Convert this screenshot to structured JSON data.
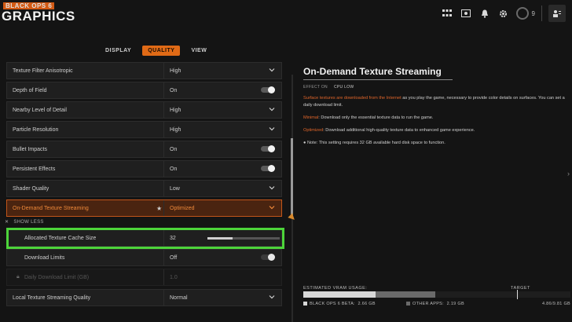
{
  "header": {
    "game_title": "BLACK OPS 6",
    "page_title": "GRAPHICS",
    "notification_count": "9"
  },
  "tabs": [
    {
      "label": "DISPLAY",
      "active": false
    },
    {
      "label": "QUALITY",
      "active": true
    },
    {
      "label": "VIEW",
      "active": false
    }
  ],
  "settings": [
    {
      "label": "Texture Filter Anisotropic",
      "value": "High",
      "control": "dropdown"
    },
    {
      "label": "Depth of Field",
      "value": "On",
      "control": "toggle"
    },
    {
      "label": "Nearby Level of Detail",
      "value": "High",
      "control": "dropdown"
    },
    {
      "label": "Particle Resolution",
      "value": "High",
      "control": "dropdown"
    },
    {
      "label": "Bullet Impacts",
      "value": "On",
      "control": "toggle"
    },
    {
      "label": "Persistent Effects",
      "value": "On",
      "control": "toggle"
    },
    {
      "label": "Shader Quality",
      "value": "Low",
      "control": "dropdown"
    },
    {
      "label": "On-Demand Texture Streaming",
      "value": "Optimized",
      "control": "dropdown"
    }
  ],
  "show_less": "SHOW LESS",
  "sub_settings": {
    "cache_label": "Allocated Texture Cache Size",
    "cache_value": "32",
    "cache_fraction": 0.35,
    "download_limits_label": "Download Limits",
    "download_limits_value": "Off",
    "daily_limit_label": "Daily Download Limit (GB)",
    "daily_limit_value": "1.0"
  },
  "local_streaming": {
    "label": "Local Texture Streaming Quality",
    "value": "Normal"
  },
  "description": {
    "title": "On-Demand Texture Streaming",
    "effect_label": "EFFECT ON",
    "effect_value": "CPU LOW",
    "p1_highlight": "Surface textures are downloaded from the Internet",
    "p1_rest": " as you play the game, necessary to provide color details on surfaces. You can set a daily download limit.",
    "p2_highlight": "Minimal",
    "p2_rest": ": Download only the essential texture data to run the game.",
    "p3_highlight": "Optimized",
    "p3_rest": ": Download additional high-quality texture data to enhanced game experience.",
    "note": "Note: This setting requires 32 GB available hard disk space to function."
  },
  "vram": {
    "label": "ESTIMATED VRAM USAGE:",
    "target_label": "TARGET",
    "game_label": "BLACK OPS 6 BETA:",
    "game_value": "2.66 GB",
    "other_label": "OTHER APPS:",
    "other_value": "2.19 GB",
    "total": "4.86/9.81 GB",
    "game_gb": 2.66,
    "other_gb": 2.19,
    "capacity_gb": 9.81
  },
  "colors": {
    "accent": "#e06a16",
    "highlight_box": "#4dd43a"
  }
}
